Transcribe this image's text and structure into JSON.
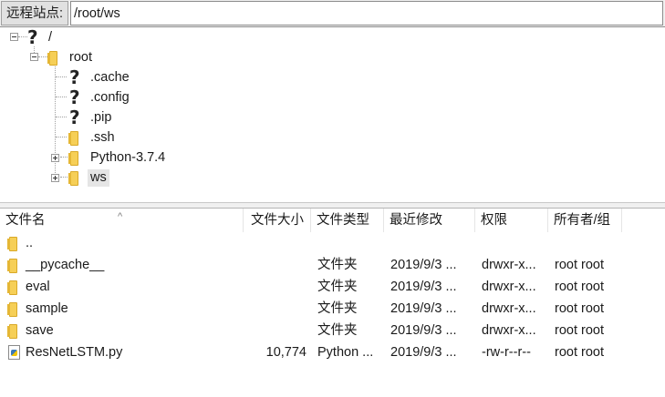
{
  "path_bar": {
    "label": "远程站点:",
    "value": "/root/ws"
  },
  "tree": [
    {
      "label": "/",
      "icon": "unknown-icon"
    },
    {
      "label": "root",
      "icon": "folder-icon"
    },
    {
      "label": ".cache",
      "icon": "unknown-icon"
    },
    {
      "label": ".config",
      "icon": "unknown-icon"
    },
    {
      "label": ".pip",
      "icon": "unknown-icon"
    },
    {
      "label": ".ssh",
      "icon": "folder-icon"
    },
    {
      "label": "Python-3.7.4",
      "icon": "folder-icon"
    },
    {
      "label": "ws",
      "icon": "folder-icon",
      "selected": true
    }
  ],
  "columns": [
    "文件名",
    "文件大小",
    "文件类型",
    "最近修改",
    "权限",
    "所有者/组"
  ],
  "files": [
    {
      "name": "..",
      "size": "",
      "type": "",
      "modified": "",
      "perms": "",
      "owner": "",
      "icon": "folder-icon"
    },
    {
      "name": "__pycache__",
      "size": "",
      "type": "文件夹",
      "modified": "2019/9/3 ...",
      "perms": "drwxr-x...",
      "owner": "root root",
      "icon": "folder-icon"
    },
    {
      "name": "eval",
      "size": "",
      "type": "文件夹",
      "modified": "2019/9/3 ...",
      "perms": "drwxr-x...",
      "owner": "root root",
      "icon": "folder-icon"
    },
    {
      "name": "sample",
      "size": "",
      "type": "文件夹",
      "modified": "2019/9/3 ...",
      "perms": "drwxr-x...",
      "owner": "root root",
      "icon": "folder-icon"
    },
    {
      "name": "save",
      "size": "",
      "type": "文件夹",
      "modified": "2019/9/3 ...",
      "perms": "drwxr-x...",
      "owner": "root root",
      "icon": "folder-icon"
    },
    {
      "name": "ResNetLSTM.py",
      "size": "10,774",
      "type": "Python ...",
      "modified": "2019/9/3 ...",
      "perms": "-rw-r--r--",
      "owner": "root root",
      "icon": "python-file-icon"
    }
  ]
}
